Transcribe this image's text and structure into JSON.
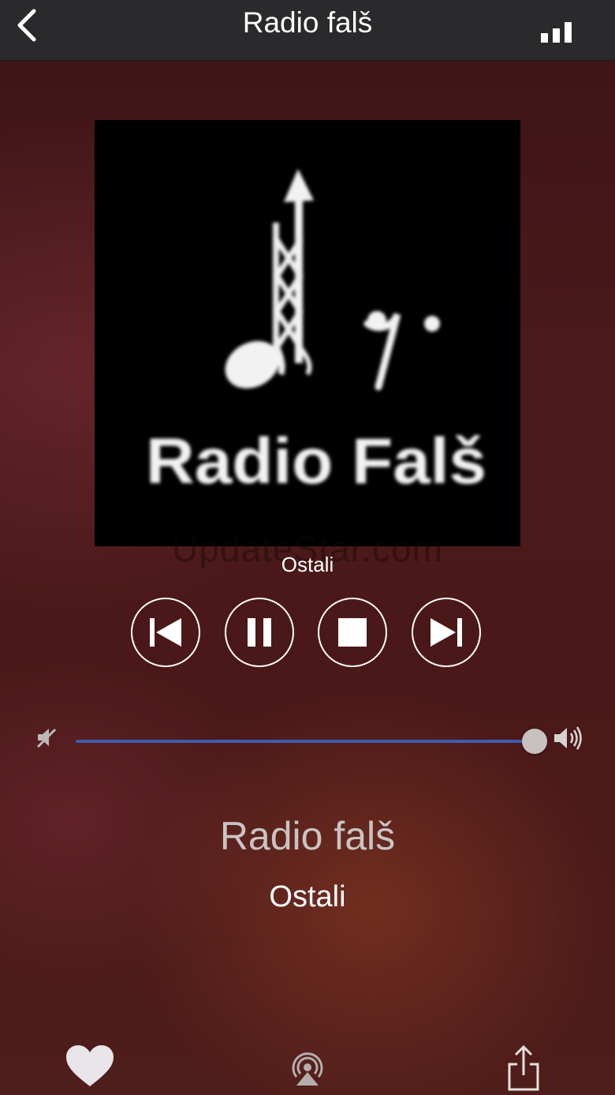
{
  "header": {
    "title": "Radio falš",
    "back_icon": "chevron-left-icon",
    "signal_icon": "signal-bars-icon"
  },
  "artwork": {
    "logo_text": "Radio Falš",
    "logo_icon": "music-note-icon"
  },
  "watermark": "UpdateStar.com",
  "now_playing": {
    "genre_small": "Ostali",
    "station_name": "Radio falš",
    "genre": "Ostali"
  },
  "controls": {
    "previous_icon": "skip-previous-icon",
    "pause_icon": "pause-icon",
    "stop_icon": "stop-icon",
    "next_icon": "skip-next-icon"
  },
  "volume": {
    "level": 1.0,
    "min_icon": "volume-mute-icon",
    "max_icon": "volume-high-icon",
    "fill_color": "#3f5bb0"
  },
  "bottom_bar": {
    "favorite_icon": "heart-icon",
    "airplay_icon": "airplay-icon",
    "share_icon": "share-icon"
  }
}
